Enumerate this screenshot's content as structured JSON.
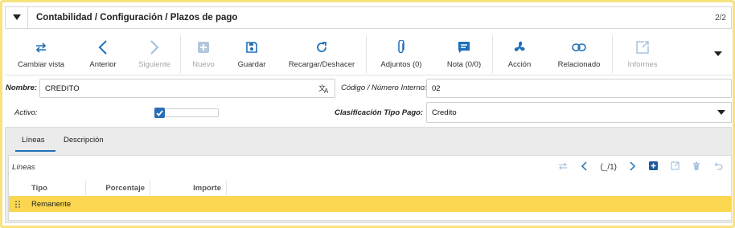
{
  "header": {
    "title": "Contabilidad / Configuración / Plazos de pago",
    "record_count": "2/2"
  },
  "toolbar": {
    "items": [
      {
        "label": "Cambiar vista",
        "icon": "switch-arrows-icon",
        "enabled": true
      },
      {
        "label": "Anterior",
        "icon": "chevron-left-icon",
        "enabled": true
      },
      {
        "label": "Siguiente",
        "icon": "chevron-right-icon",
        "enabled": false
      },
      {
        "label": "Nuevo",
        "icon": "plus-square-icon",
        "enabled": false
      },
      {
        "label": "Guardar",
        "icon": "save-icon",
        "enabled": true
      },
      {
        "label": "Recargar/Deshacer",
        "icon": "reload-icon",
        "enabled": true
      },
      {
        "label": "Adjuntos (0)",
        "icon": "paperclip-icon",
        "enabled": true
      },
      {
        "label": "Nota (0/0)",
        "icon": "note-icon",
        "enabled": true
      },
      {
        "label": "Acción",
        "icon": "fan-icon",
        "enabled": true
      },
      {
        "label": "Relacionado",
        "icon": "link-icon",
        "enabled": true
      },
      {
        "label": "Informes",
        "icon": "report-icon",
        "enabled": false
      }
    ],
    "more_icon": "caret-down-icon"
  },
  "form": {
    "nombre_label": "Nombre:",
    "nombre_value": "CREDITO",
    "translate_icon": "translate-icon",
    "codigo_label": "Código / Número Interno:",
    "codigo_value": "02",
    "activo_label": "Activo:",
    "activo_checked": true,
    "clasificacion_label": "Clasificación Tipo Pago:",
    "clasificacion_value": "Credito"
  },
  "tabs": [
    {
      "label": "Líneas",
      "active": true
    },
    {
      "label": "Descripción",
      "active": false
    }
  ],
  "grid": {
    "title": "Líneas",
    "nav_count": "(_/1)",
    "columns": [
      "Tipo",
      "Porcentaje",
      "Importe"
    ],
    "rows": [
      {
        "tipo": "Remanente",
        "porcentaje": "",
        "importe": ""
      }
    ]
  },
  "colors": {
    "accent": "#1e6fb8",
    "highlight_row": "#fbd650",
    "frame": "#f7e27f"
  }
}
